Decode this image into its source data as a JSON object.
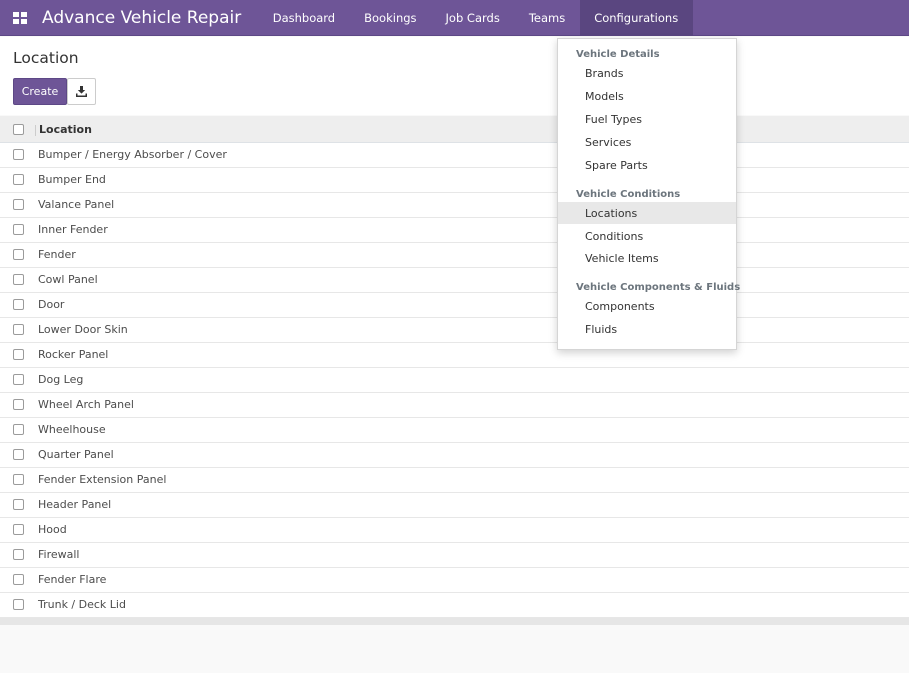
{
  "navbar": {
    "app_title": "Advance Vehicle Repair",
    "menu": [
      "Dashboard",
      "Bookings",
      "Job Cards",
      "Teams",
      "Configurations"
    ],
    "active_menu": "Configurations",
    "color": "#6e5597"
  },
  "control_panel": {
    "breadcrumb": "Location",
    "create_label": "Create",
    "download_icon": "download-icon"
  },
  "list": {
    "column_header": "Location",
    "rows": [
      "Bumper / Energy Absorber / Cover",
      "Bumper End",
      "Valance Panel",
      "Inner Fender",
      "Fender",
      "Cowl Panel",
      "Door",
      "Lower Door Skin",
      "Rocker Panel",
      "Dog Leg",
      "Wheel Arch Panel",
      "Wheelhouse",
      "Quarter Panel",
      "Fender Extension Panel",
      "Header Panel",
      "Hood",
      "Firewall",
      "Fender Flare",
      "Trunk / Deck Lid"
    ]
  },
  "dropdown": {
    "sections": [
      {
        "header": "Vehicle Details",
        "items": [
          "Brands",
          "Models",
          "Fuel Types",
          "Services",
          "Spare Parts"
        ]
      },
      {
        "header": "Vehicle Conditions",
        "items": [
          "Locations",
          "Conditions",
          "Vehicle Items"
        ]
      },
      {
        "header": "Vehicle Components & Fluids",
        "items": [
          "Components",
          "Fluids"
        ]
      }
    ],
    "active_item": "Locations"
  }
}
